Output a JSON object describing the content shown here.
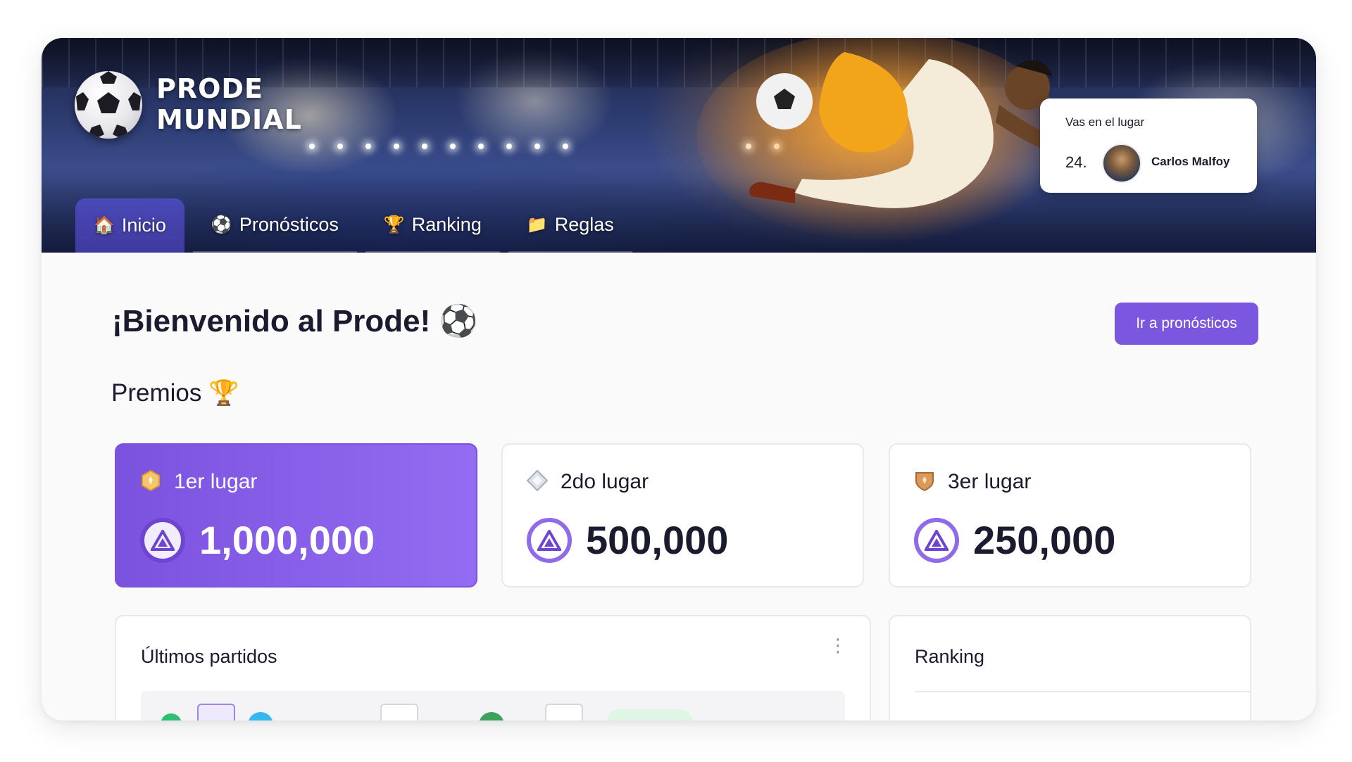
{
  "app": {
    "logo_line1": "PRODE",
    "logo_line2": "MUNDIAL",
    "accent_color": "#7b57e0"
  },
  "user": {
    "place_label": "Vas en el lugar",
    "rank": "24.",
    "name": "Carlos Malfoy"
  },
  "nav": {
    "tabs": [
      {
        "label": "Inicio",
        "icon": "house-icon",
        "glyph": "🏠",
        "active": true
      },
      {
        "label": "Pronósticos",
        "icon": "soccer-ball-icon",
        "glyph": "⚽",
        "active": false
      },
      {
        "label": "Ranking",
        "icon": "trophy-icon",
        "glyph": "🏆",
        "active": false
      },
      {
        "label": "Reglas",
        "icon": "folder-icon",
        "glyph": "📁",
        "active": false
      }
    ]
  },
  "main": {
    "welcome": "¡Bienvenido al Prode! ⚽",
    "cta_label": "Ir a pronósticos",
    "prizes_title": "Premios 🏆",
    "prizes": [
      {
        "place": "1er lugar",
        "amount": "1,000,000",
        "badge": "gold-medal-icon"
      },
      {
        "place": "2do lugar",
        "amount": "500,000",
        "badge": "silver-medal-icon"
      },
      {
        "place": "3er lugar",
        "amount": "250,000",
        "badge": "bronze-medal-icon"
      }
    ],
    "latest_matches_title": "Últimos partidos",
    "ranking_title": "Ranking"
  }
}
